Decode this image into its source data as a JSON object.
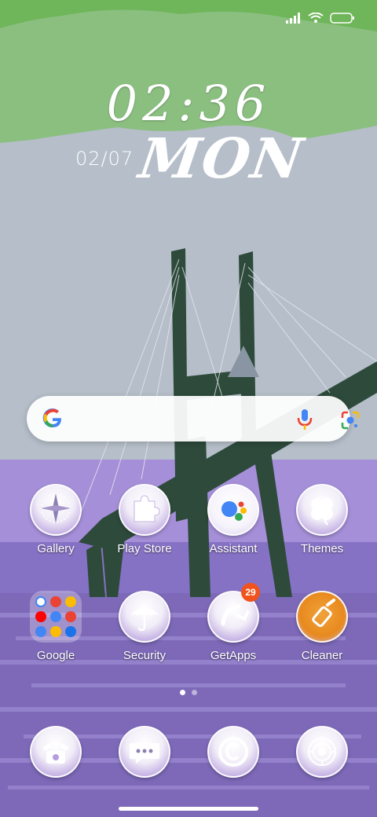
{
  "status_bar": {
    "signal_icon": "signal-icon",
    "wifi_icon": "wifi-icon",
    "battery_icon": "battery-icon"
  },
  "clock": {
    "time": "02:36",
    "date": "02/07",
    "day": "MON"
  },
  "search_bar": {
    "logo": "google-g-icon",
    "mic": "mic-icon",
    "lens": "google-lens-icon"
  },
  "apps": {
    "row1": [
      {
        "label": "Gallery",
        "icon": "compass-icon"
      },
      {
        "label": "Play Store",
        "icon": "puzzle-icon"
      },
      {
        "label": "Assistant",
        "icon": "assistant-icon"
      },
      {
        "label": "Themes",
        "icon": "clover-icon"
      }
    ],
    "row2": [
      {
        "label": "Google",
        "icon": "folder-icon"
      },
      {
        "label": "Security",
        "icon": "umbrella-icon"
      },
      {
        "label": "GetApps",
        "icon": "arrow-icon",
        "badge": "29"
      },
      {
        "label": "Cleaner",
        "icon": "broom-icon"
      }
    ],
    "dock": [
      {
        "icon": "phone-icon"
      },
      {
        "icon": "message-icon"
      },
      {
        "icon": "copyright-icon"
      },
      {
        "icon": "camera-aperture-icon"
      }
    ]
  },
  "page_indicator": {
    "pages": 2,
    "current": 1
  },
  "colors": {
    "sky_green": "#7fbf72",
    "sky_gray": "#b8c0cc",
    "lavender": "#9b85d2",
    "water": "#7d68b8",
    "bridge": "#2c4a3a",
    "badge": "#f0531c"
  }
}
